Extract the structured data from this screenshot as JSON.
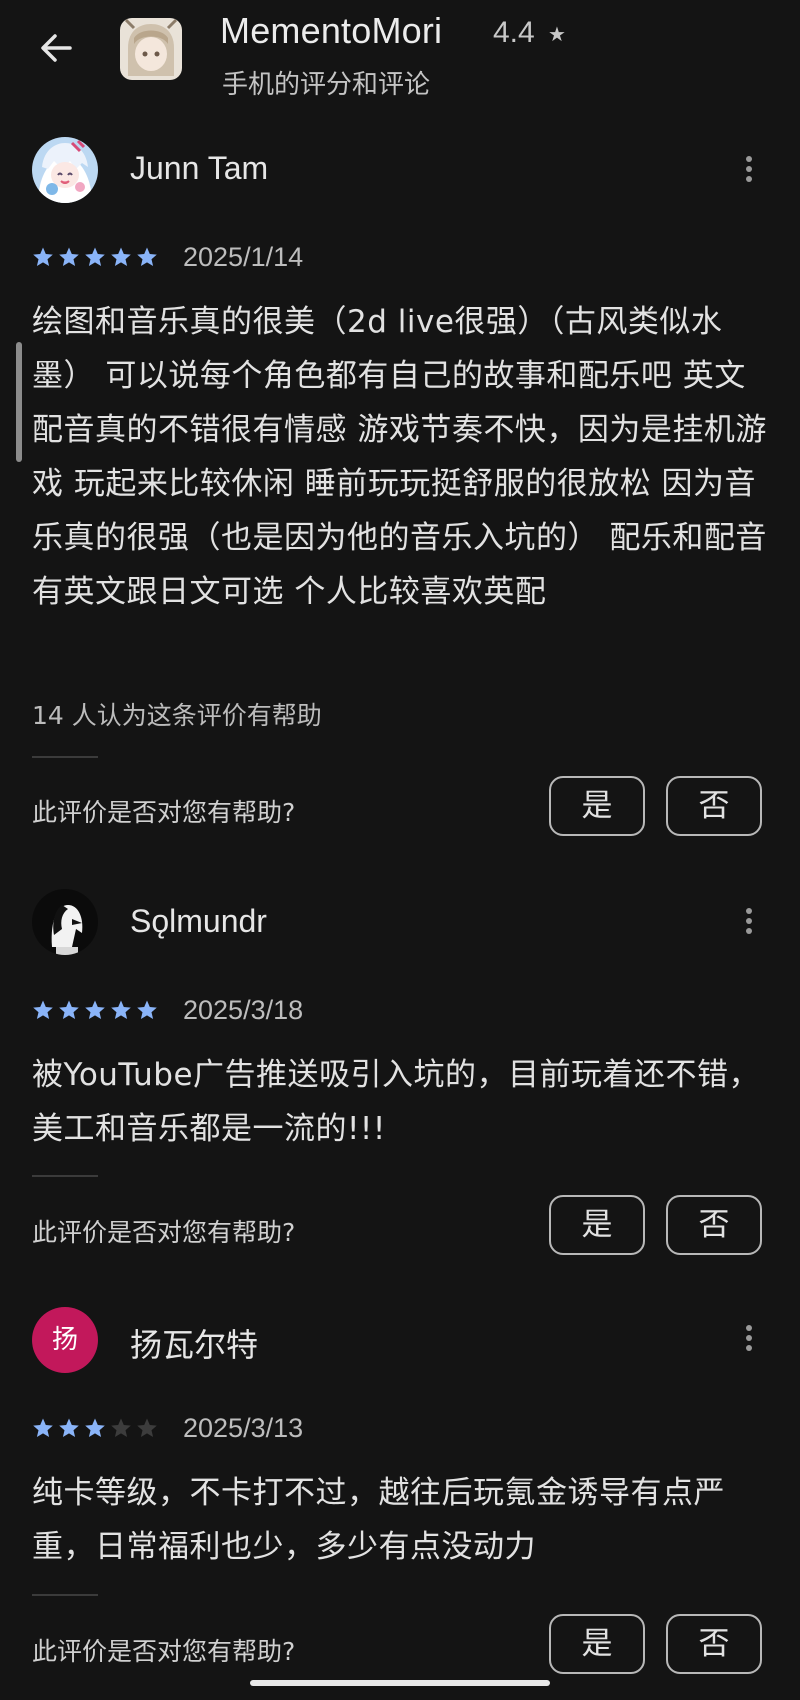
{
  "header": {
    "back_icon": "arrow-left-icon",
    "app_name": "MementoMori",
    "rating": "4.4",
    "star": "★",
    "subtitle": "手机的评分和评论"
  },
  "colors": {
    "background": "#141414",
    "star_filled": "#8ab4f8",
    "star_empty": "#3c3c3c",
    "avatar_yang": "#c2185b"
  },
  "reviews": [
    {
      "name": "Junn Tam",
      "rating": 5,
      "date": "2025/1/14",
      "text": "绘图和音乐真的很美（2d live很强）（古风类似水墨） 可以说每个角色都有自己的故事和配乐吧 英文配音真的不错很有情感 游戏节奏不快，因为是挂机游戏 玩起来比较休闲 睡前玩玩挺舒服的很放松 因为音乐真的很强（也是因为他的音乐入坑的） 配乐和配音有英文跟日文可选 个人比较喜欢英配",
      "helpful_count": "14 人认为这条评价有帮助",
      "helpful_question": "此评价是否对您有帮助?",
      "yes": "是",
      "no": "否"
    },
    {
      "name": "Sǫlmundr",
      "rating": 5,
      "date": "2025/3/18",
      "text": "被YouTube广告推送吸引入坑的，目前玩着还不错，美工和音乐都是一流的!!!",
      "helpful_question": "此评价是否对您有帮助?",
      "yes": "是",
      "no": "否"
    },
    {
      "name": "扬瓦尔特",
      "avatar_letter": "扬",
      "rating": 3,
      "date": "2025/3/13",
      "text": "纯卡等级，不卡打不过，越往后玩氪金诱导有点严重，日常福利也少，多少有点没动力",
      "helpful_question": "此评价是否对您有帮助?",
      "yes": "是",
      "no": "否"
    }
  ]
}
